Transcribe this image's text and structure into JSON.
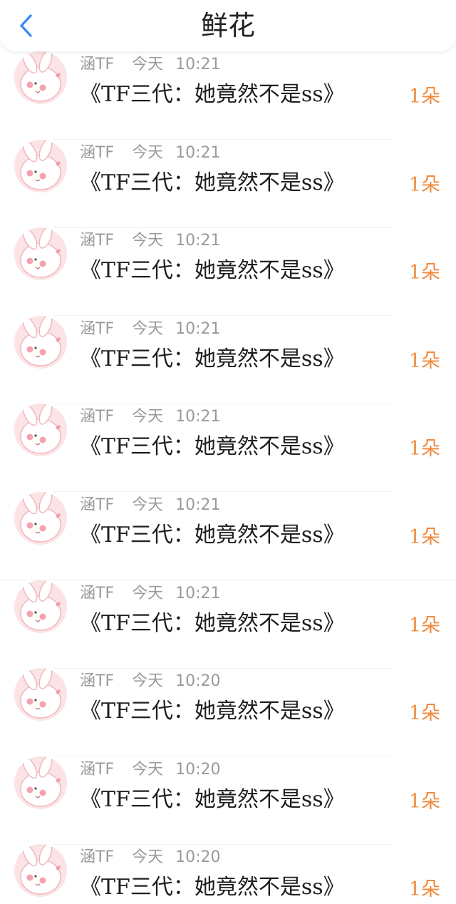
{
  "header": {
    "title": "鲜花",
    "back_icon": "chevron-left-icon",
    "accent_color": "#3b8cf5"
  },
  "items": [
    {
      "user": "涵TF",
      "date": "今天",
      "time": "10:21",
      "title": "《TF三代：她竟然不是ss》",
      "count": "1朵"
    },
    {
      "user": "涵TF",
      "date": "今天",
      "time": "10:21",
      "title": "《TF三代：她竟然不是ss》",
      "count": "1朵"
    },
    {
      "user": "涵TF",
      "date": "今天",
      "time": "10:21",
      "title": "《TF三代：她竟然不是ss》",
      "count": "1朵"
    },
    {
      "user": "涵TF",
      "date": "今天",
      "time": "10:21",
      "title": "《TF三代：她竟然不是ss》",
      "count": "1朵"
    },
    {
      "user": "涵TF",
      "date": "今天",
      "time": "10:21",
      "title": "《TF三代：她竟然不是ss》",
      "count": "1朵"
    },
    {
      "user": "涵TF",
      "date": "今天",
      "time": "10:21",
      "title": "《TF三代：她竟然不是ss》",
      "count": "1朵"
    },
    {
      "user": "涵TF",
      "date": "今天",
      "time": "10:21",
      "title": "《TF三代：她竟然不是ss》",
      "count": "1朵"
    },
    {
      "user": "涵TF",
      "date": "今天",
      "time": "10:20",
      "title": "《TF三代：她竟然不是ss》",
      "count": "1朵"
    },
    {
      "user": "涵TF",
      "date": "今天",
      "time": "10:20",
      "title": "《TF三代：她竟然不是ss》",
      "count": "1朵"
    },
    {
      "user": "涵TF",
      "date": "今天",
      "time": "10:20",
      "title": "《TF三代：她竟然不是ss》",
      "count": "1朵"
    }
  ],
  "colors": {
    "count": "#ef8b3f",
    "meta": "#9a9a9a",
    "avatar_bg": "#fbe3e6"
  }
}
